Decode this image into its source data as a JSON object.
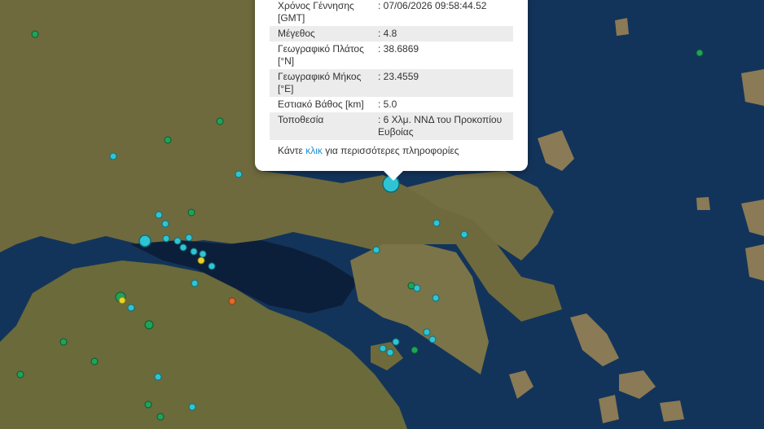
{
  "popup": {
    "rows": [
      {
        "label": "Χρόνος Γέννησης [GMT]",
        "value": ": 07/06/2026 09:58:44.52"
      },
      {
        "label": "Μέγεθος",
        "value": ": 4.8"
      },
      {
        "label": "Γεωγραφικό Πλάτος [°N]",
        "value": ": 38.6869"
      },
      {
        "label": "Γεωγραφικό Μήκος [°E]",
        "value": ": 23.4559"
      },
      {
        "label": "Εστιακό Βάθος [km]",
        "value": ": 5.0"
      },
      {
        "label": "Τοποθεσία",
        "value": ": 6 Χλμ. ΝΝΔ του Προκοπίου Ευβοίας"
      }
    ],
    "more_prefix": "Κάντε ",
    "more_link": "κλικ",
    "more_suffix": " για περισσότερες πληροφορίες"
  },
  "colors": {
    "sea": "#11304f",
    "land": "#6e6a3c",
    "marker_cyan": "#2fc4d4",
    "marker_green": "#1fa35a",
    "marker_yellow": "#e8d22a",
    "marker_orange": "#e06a2a",
    "link": "#1a8fd6"
  },
  "map": {
    "marker_legend_note": ""
  }
}
